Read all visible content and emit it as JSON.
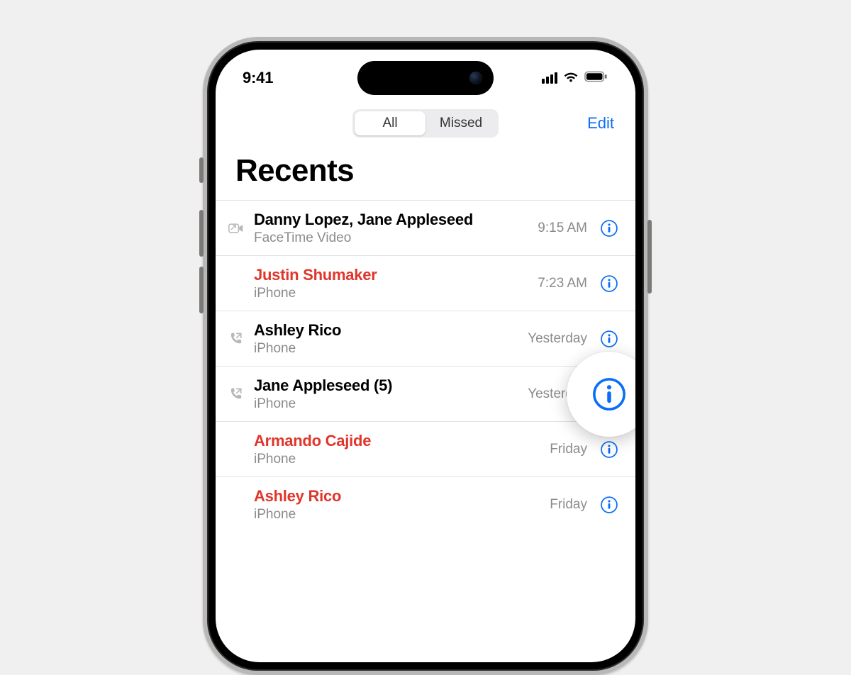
{
  "status": {
    "time": "9:41"
  },
  "nav": {
    "segment_all": "All",
    "segment_missed": "Missed",
    "edit": "Edit"
  },
  "title": "Recents",
  "colors": {
    "accent": "#0b6ef6",
    "missed": "#e0352b",
    "secondary": "#8b8b8f"
  },
  "calls": [
    {
      "name": "Danny Lopez, Jane Appleseed",
      "sub": "FaceTime Video",
      "time": "9:15 AM",
      "missed": false,
      "icon": "facetime-outgoing-icon"
    },
    {
      "name": "Justin Shumaker",
      "sub": "iPhone",
      "time": "7:23 AM",
      "missed": true,
      "icon": ""
    },
    {
      "name": "Ashley Rico",
      "sub": "iPhone",
      "time": "Yesterday",
      "missed": false,
      "icon": "phone-outgoing-icon"
    },
    {
      "name": "Jane Appleseed (5)",
      "sub": "iPhone",
      "time": "Yesterday",
      "missed": false,
      "icon": "phone-outgoing-icon"
    },
    {
      "name": "Armando Cajide",
      "sub": "iPhone",
      "time": "Friday",
      "missed": true,
      "icon": ""
    },
    {
      "name": "Ashley Rico",
      "sub": "iPhone",
      "time": "Friday",
      "missed": true,
      "icon": ""
    }
  ],
  "zoom_bubble": {
    "row_index": 3
  }
}
